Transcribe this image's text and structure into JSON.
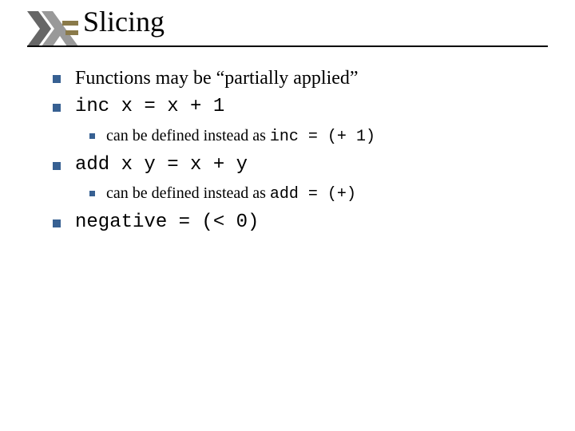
{
  "title": "Slicing",
  "bullets": {
    "b1": "Functions may be “partially applied”",
    "b2": "inc x = x + 1",
    "b2a_prefix": "can be defined instead as  ",
    "b2a_code": "inc = (+ 1)",
    "b3": "add x y = x + y",
    "b3a_prefix": "can be defined instead as  ",
    "b3a_code": "add = (+)",
    "b4": "negative = (< 0)"
  },
  "colors": {
    "accent": "#376092"
  }
}
